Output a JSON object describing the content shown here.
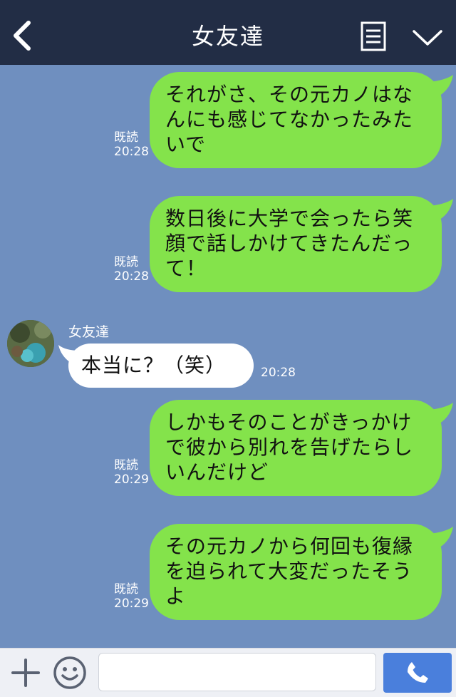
{
  "header": {
    "title": "女友達",
    "back_icon": "chevron-left-icon",
    "menu_icon": "menu-icon",
    "expand_icon": "chevron-down-icon"
  },
  "messages": [
    {
      "direction": "out",
      "text": "それがさ、その元カノはなんにも感じてなかったみたいで",
      "read": "既読",
      "time": "20:28"
    },
    {
      "direction": "out",
      "text": "数日後に大学で会ったら笑顔で話しかけてきたんだって！",
      "read": "既読",
      "time": "20:28"
    },
    {
      "direction": "in",
      "sender": "女友達",
      "text": "本当に？（笑）",
      "time": "20:28"
    },
    {
      "direction": "out",
      "text": "しかもそのことがきっかけで彼から別れを告げたらしいんだけど",
      "read": "既読",
      "time": "20:29"
    },
    {
      "direction": "out",
      "text": "その元カノから何回も復縁を迫られて大変だったそうよ",
      "read": "既読",
      "time": "20:29"
    }
  ],
  "footer": {
    "plus_icon": "plus-icon",
    "emoji_icon": "smiley-icon",
    "input_value": "",
    "call_icon": "phone-icon"
  },
  "colors": {
    "header_bg": "#222d45",
    "chat_bg": "#6f8fbf",
    "outgoing_bubble": "#84e34b",
    "incoming_bubble": "#ffffff",
    "call_button": "#4a7fdc"
  }
}
